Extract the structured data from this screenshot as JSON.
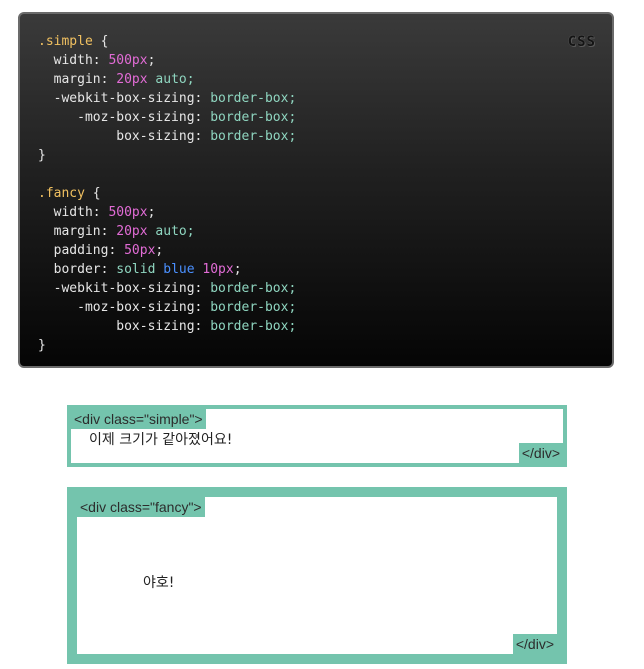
{
  "code_panel": {
    "language_label": "CSS",
    "lines": [
      [
        {
          "t": ".simple",
          "c": "sel"
        },
        {
          "t": " {",
          "c": "prop"
        }
      ],
      [
        {
          "t": "  width: ",
          "c": "prop"
        },
        {
          "t": "500px",
          "c": "num"
        },
        {
          "t": ";",
          "c": "prop"
        }
      ],
      [
        {
          "t": "  margin: ",
          "c": "prop"
        },
        {
          "t": "20px",
          "c": "num"
        },
        {
          "t": " auto;",
          "c": "val"
        }
      ],
      [
        {
          "t": "  -webkit-box-sizing: ",
          "c": "prop"
        },
        {
          "t": "border-box;",
          "c": "val"
        }
      ],
      [
        {
          "t": "     -moz-box-sizing: ",
          "c": "prop"
        },
        {
          "t": "border-box;",
          "c": "val"
        }
      ],
      [
        {
          "t": "          box-sizing: ",
          "c": "prop"
        },
        {
          "t": "border-box;",
          "c": "val"
        }
      ],
      [
        {
          "t": "}",
          "c": "prop"
        }
      ],
      [
        {
          "t": "",
          "c": "prop"
        }
      ],
      [
        {
          "t": ".fancy",
          "c": "sel"
        },
        {
          "t": " {",
          "c": "prop"
        }
      ],
      [
        {
          "t": "  width: ",
          "c": "prop"
        },
        {
          "t": "500px",
          "c": "num"
        },
        {
          "t": ";",
          "c": "prop"
        }
      ],
      [
        {
          "t": "  margin: ",
          "c": "prop"
        },
        {
          "t": "20px",
          "c": "num"
        },
        {
          "t": " auto;",
          "c": "val"
        }
      ],
      [
        {
          "t": "  padding: ",
          "c": "prop"
        },
        {
          "t": "50px",
          "c": "num"
        },
        {
          "t": ";",
          "c": "prop"
        }
      ],
      [
        {
          "t": "  border: ",
          "c": "prop"
        },
        {
          "t": "solid ",
          "c": "val"
        },
        {
          "t": "blue ",
          "c": "blue"
        },
        {
          "t": "10px",
          "c": "num"
        },
        {
          "t": ";",
          "c": "prop"
        }
      ],
      [
        {
          "t": "  -webkit-box-sizing: ",
          "c": "prop"
        },
        {
          "t": "border-box;",
          "c": "val"
        }
      ],
      [
        {
          "t": "     -moz-box-sizing: ",
          "c": "prop"
        },
        {
          "t": "border-box;",
          "c": "val"
        }
      ],
      [
        {
          "t": "          box-sizing: ",
          "c": "prop"
        },
        {
          "t": "border-box;",
          "c": "val"
        }
      ],
      [
        {
          "t": "}",
          "c": "prop"
        }
      ]
    ]
  },
  "simple_box": {
    "open_tag": "<div class=\"simple\">",
    "text": "이제 크기가 같아졌어요!",
    "close_tag": "</div>"
  },
  "fancy_box": {
    "open_tag": "<div class=\"fancy\">",
    "text": "야호!",
    "close_tag": "</div>"
  },
  "colors": {
    "box_border": "#74c4ad",
    "selector": "#f0c060",
    "number": "#e26cd6",
    "value": "#8fd6c0",
    "blue_keyword": "#4a90ff"
  }
}
